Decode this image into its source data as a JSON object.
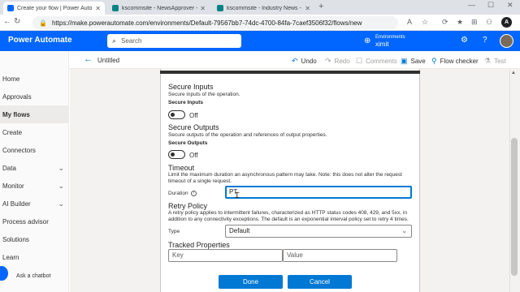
{
  "browser": {
    "tabs": [
      {
        "title": "Create your flow | Power Automate",
        "fav_color": "#0066ff",
        "active": true
      },
      {
        "title": "kscommsite - NewsApprover - A",
        "fav_color": "#038387",
        "active": false
      },
      {
        "title": "kscommsite - Industry News - A",
        "fav_color": "#038387",
        "active": false
      }
    ],
    "url": "https://make.powerautomate.com/environments/Default-79567bb7-74dc-4700-84fa-7caef3506f32/flows/new",
    "profile_initial": "A"
  },
  "header": {
    "app_name": "Power Automate",
    "search_placeholder": "Search",
    "env_label": "Environments",
    "env_name": "ximit",
    "accent": "#0066ff"
  },
  "nav": {
    "items": [
      {
        "label": "Home",
        "chevron": false,
        "selected": false
      },
      {
        "label": "Approvals",
        "chevron": false,
        "selected": false
      },
      {
        "label": "My flows",
        "chevron": false,
        "selected": true
      },
      {
        "label": "Create",
        "chevron": false,
        "selected": false
      },
      {
        "label": "Connectors",
        "chevron": false,
        "selected": false
      },
      {
        "label": "Data",
        "chevron": true,
        "selected": false
      },
      {
        "label": "Monitor",
        "chevron": true,
        "selected": false
      },
      {
        "label": "AI Builder",
        "chevron": true,
        "selected": false
      },
      {
        "label": "Process advisor",
        "chevron": false,
        "selected": false
      },
      {
        "label": "Solutions",
        "chevron": false,
        "selected": false
      },
      {
        "label": "Learn",
        "chevron": false,
        "selected": false
      }
    ],
    "chatbot_label": "Ask a chatbot"
  },
  "commandbar": {
    "title": "Untitled",
    "undo": "Undo",
    "redo": "Redo",
    "comments": "Comments",
    "save": "Save",
    "flow_checker": "Flow checker",
    "test": "Test"
  },
  "settings": {
    "secure_inputs": {
      "title": "Secure Inputs",
      "desc": "Secure inputs of the operation.",
      "sub": "Secure Inputs",
      "state": "Off"
    },
    "secure_outputs": {
      "title": "Secure Outputs",
      "desc": "Secure outputs of the operation and references of output properties.",
      "sub": "Secure Outputs",
      "state": "Off"
    },
    "timeout": {
      "title": "Timeout",
      "desc": "Limit the maximum duration an asynchronous pattern may take. Note: this does not alter the request timeout of a single request.",
      "duration_label": "Duration",
      "duration_value": "PT"
    },
    "retry": {
      "title": "Retry Policy",
      "desc": "A retry policy applies to intermittent failures, characterized as HTTP status codes 408, 429, and 5xx, in addition to any connectivity exceptions. The default is an exponential interval policy set to retry 4 times.",
      "type_label": "Type",
      "type_value": "Default"
    },
    "tracked": {
      "title": "Tracked Properties",
      "key_placeholder": "Key",
      "value_placeholder": "Value"
    },
    "done": "Done",
    "cancel": "Cancel"
  }
}
